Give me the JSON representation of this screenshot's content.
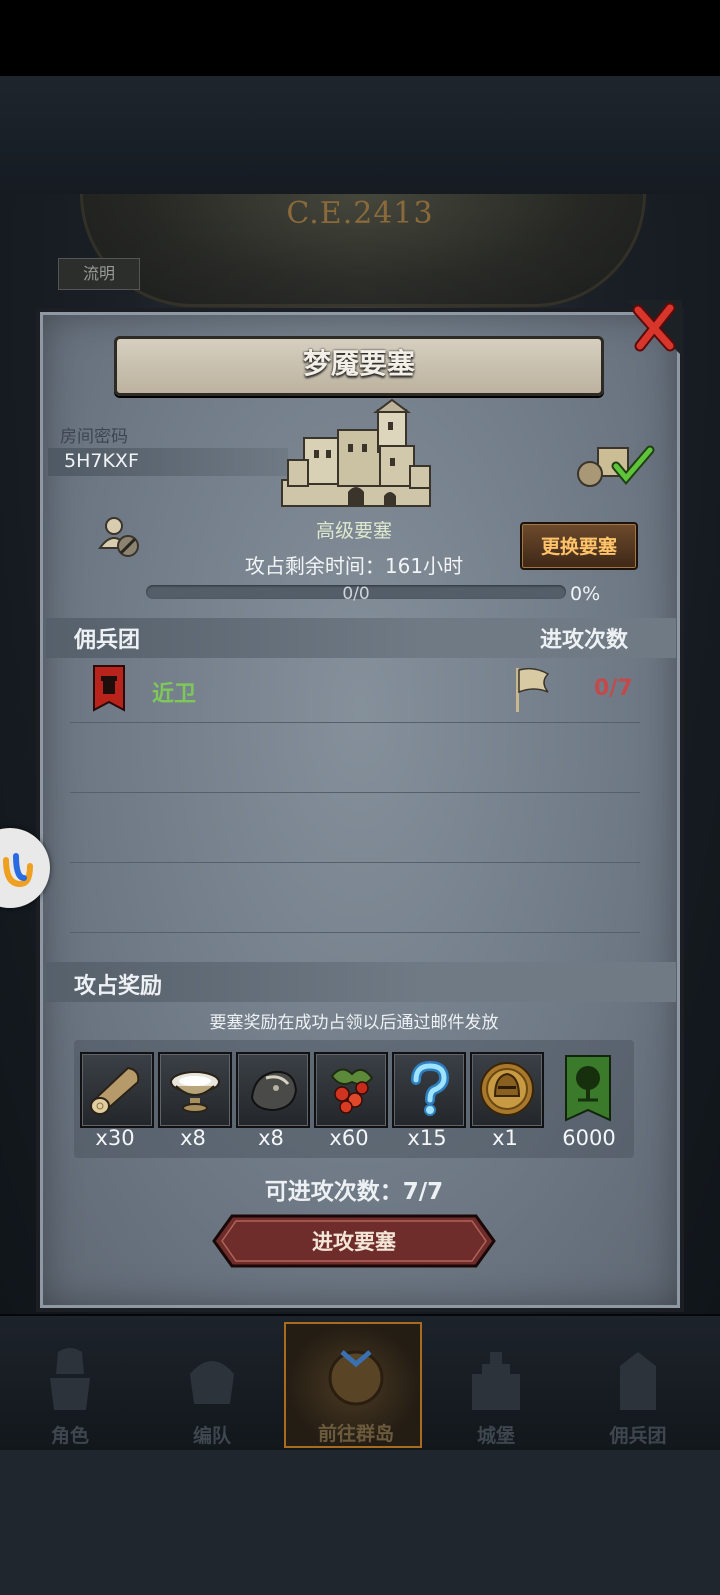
{
  "background": {
    "year_label": "C.E.2413",
    "side_tag": "流明"
  },
  "dialog": {
    "title": "梦魇要塞",
    "room_code_label": "房间密码",
    "room_code": "5H7KXF",
    "fortress_type": "高级要塞",
    "change_button": "更换要塞",
    "remaining_time": "攻占剩余时间：161小时",
    "progress": {
      "text": "0/0",
      "percent_label": "0%",
      "fraction": 0.0
    },
    "mercenary_header": "佣兵团",
    "attacks_header": "进攻次数",
    "mercenaries": [
      {
        "name": "近卫",
        "attacks": "0/7"
      }
    ],
    "reward_header": "攻占奖励",
    "reward_note": "要塞奖励在成功占领以后通过邮件发放",
    "rewards": [
      {
        "icon": "log-icon",
        "qty": "x30"
      },
      {
        "icon": "bowl-icon",
        "qty": "x8"
      },
      {
        "icon": "ore-icon",
        "qty": "x8"
      },
      {
        "icon": "berries-icon",
        "qty": "x60"
      },
      {
        "icon": "mystery-icon",
        "qty": "x15"
      },
      {
        "icon": "helmet-coin-icon",
        "qty": "x1"
      },
      {
        "icon": "tree-banner-icon",
        "qty": "6000"
      }
    ],
    "attempts_label": "可进攻次数：7/7",
    "attack_button": "进攻要塞"
  },
  "nav": [
    {
      "label": "角色",
      "icon": "knight-icon"
    },
    {
      "label": "编队",
      "icon": "formation-icon"
    },
    {
      "label": "前往群岛",
      "icon": "compass-icon",
      "active": true
    },
    {
      "label": "城堡",
      "icon": "castle-icon"
    },
    {
      "label": "佣兵团",
      "icon": "mercenary-icon"
    }
  ],
  "colors": {
    "accent_gold": "#ffc36a",
    "merc_green": "#7ec85a",
    "attack_red": "#c24a4a"
  }
}
